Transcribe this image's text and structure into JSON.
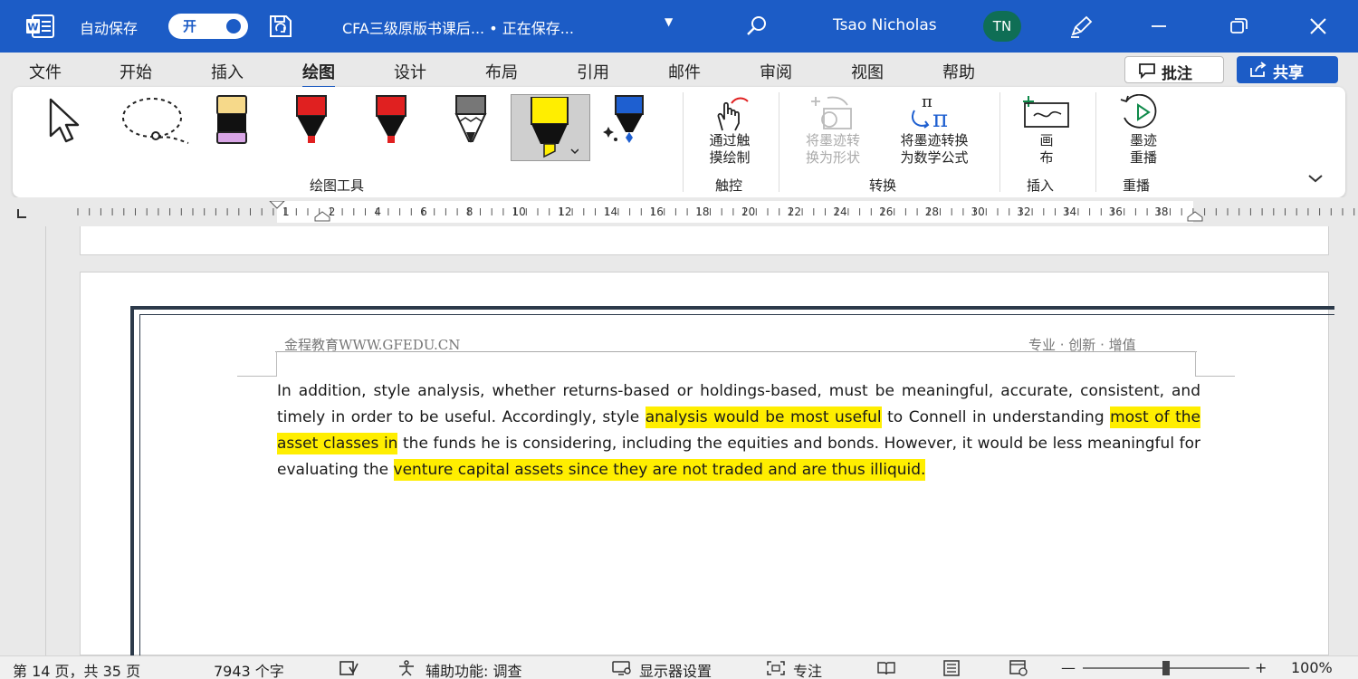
{
  "titlebar": {
    "autosave_label": "自动保存",
    "autosave_state": "开",
    "doc_title": "CFA三级原版书课后... • 正在保存...",
    "user_name": "Tsao Nicholas",
    "user_initials": "TN",
    "bg_color": "#1c5cc6",
    "avatar_color": "#0f6e55"
  },
  "tabs": [
    {
      "label": "文件"
    },
    {
      "label": "开始"
    },
    {
      "label": "插入"
    },
    {
      "label": "绘图",
      "active": true
    },
    {
      "label": "设计"
    },
    {
      "label": "布局"
    },
    {
      "label": "引用"
    },
    {
      "label": "邮件"
    },
    {
      "label": "审阅"
    },
    {
      "label": "视图"
    },
    {
      "label": "帮助"
    }
  ],
  "actions": {
    "comments_label": "批注",
    "share_label": "共享"
  },
  "ribbon": {
    "groups": {
      "drawing_tools": "绘图工具",
      "touch": "触控",
      "convert": "转换",
      "insert": "插入",
      "replay": "重播"
    },
    "buttons": {
      "draw_with_touch": [
        "通过触",
        "摸绘制"
      ],
      "ink_to_shape": [
        "将墨迹转",
        "换为形状"
      ],
      "ink_to_math": [
        "将墨迹转换",
        "为数学公式"
      ],
      "canvas": [
        "画",
        "布"
      ],
      "ink_replay": [
        "墨迹",
        "重播"
      ]
    },
    "pens": [
      {
        "name": "eraser",
        "color": "#f6d98a"
      },
      {
        "name": "red-pen-1",
        "color": "#e02020"
      },
      {
        "name": "red-pen-2",
        "color": "#e02020"
      },
      {
        "name": "pencil",
        "color": "#777777"
      },
      {
        "name": "highlighter",
        "color": "#ffee00"
      },
      {
        "name": "galaxy-pen",
        "color": "#1e5fd0"
      }
    ]
  },
  "ruler": {
    "labels": [
      "1",
      "2",
      "4",
      "6",
      "8",
      "10",
      "12",
      "14",
      "16",
      "18",
      "20",
      "22",
      "24",
      "26",
      "28",
      "30",
      "32",
      "34",
      "36",
      "38"
    ]
  },
  "document": {
    "header_left": "金程教育WWW.GFEDU.CN",
    "header_right": "专业 · 创新 · 增值",
    "segments": [
      {
        "text": "In addition, style analysis, whether returns-based or holdings-based, must be meaningful, accurate, consistent, and timely in order to be useful. Accordingly, style ",
        "highlight": false
      },
      {
        "text": "analysis would be most useful",
        "highlight": true
      },
      {
        "text": " to Connell in understanding ",
        "highlight": false
      },
      {
        "text": "most of the asset classes in",
        "highlight": true
      },
      {
        "text": " the funds he is considering, including the equities and bonds. However, it would be less meaningful for evaluating the ",
        "highlight": false
      },
      {
        "text": "venture capital assets since they are not traded and are thus illiquid.",
        "highlight": true
      }
    ],
    "highlight_color": "#ffee00"
  },
  "statusbar": {
    "page_info": "第 14 页，共 35 页",
    "word_count": "7943 个字",
    "accessibility": "辅助功能: 调查",
    "display_settings": "显示器设置",
    "focus": "专注",
    "zoom_minus": "—",
    "zoom_plus": "+",
    "zoom": "100%"
  }
}
